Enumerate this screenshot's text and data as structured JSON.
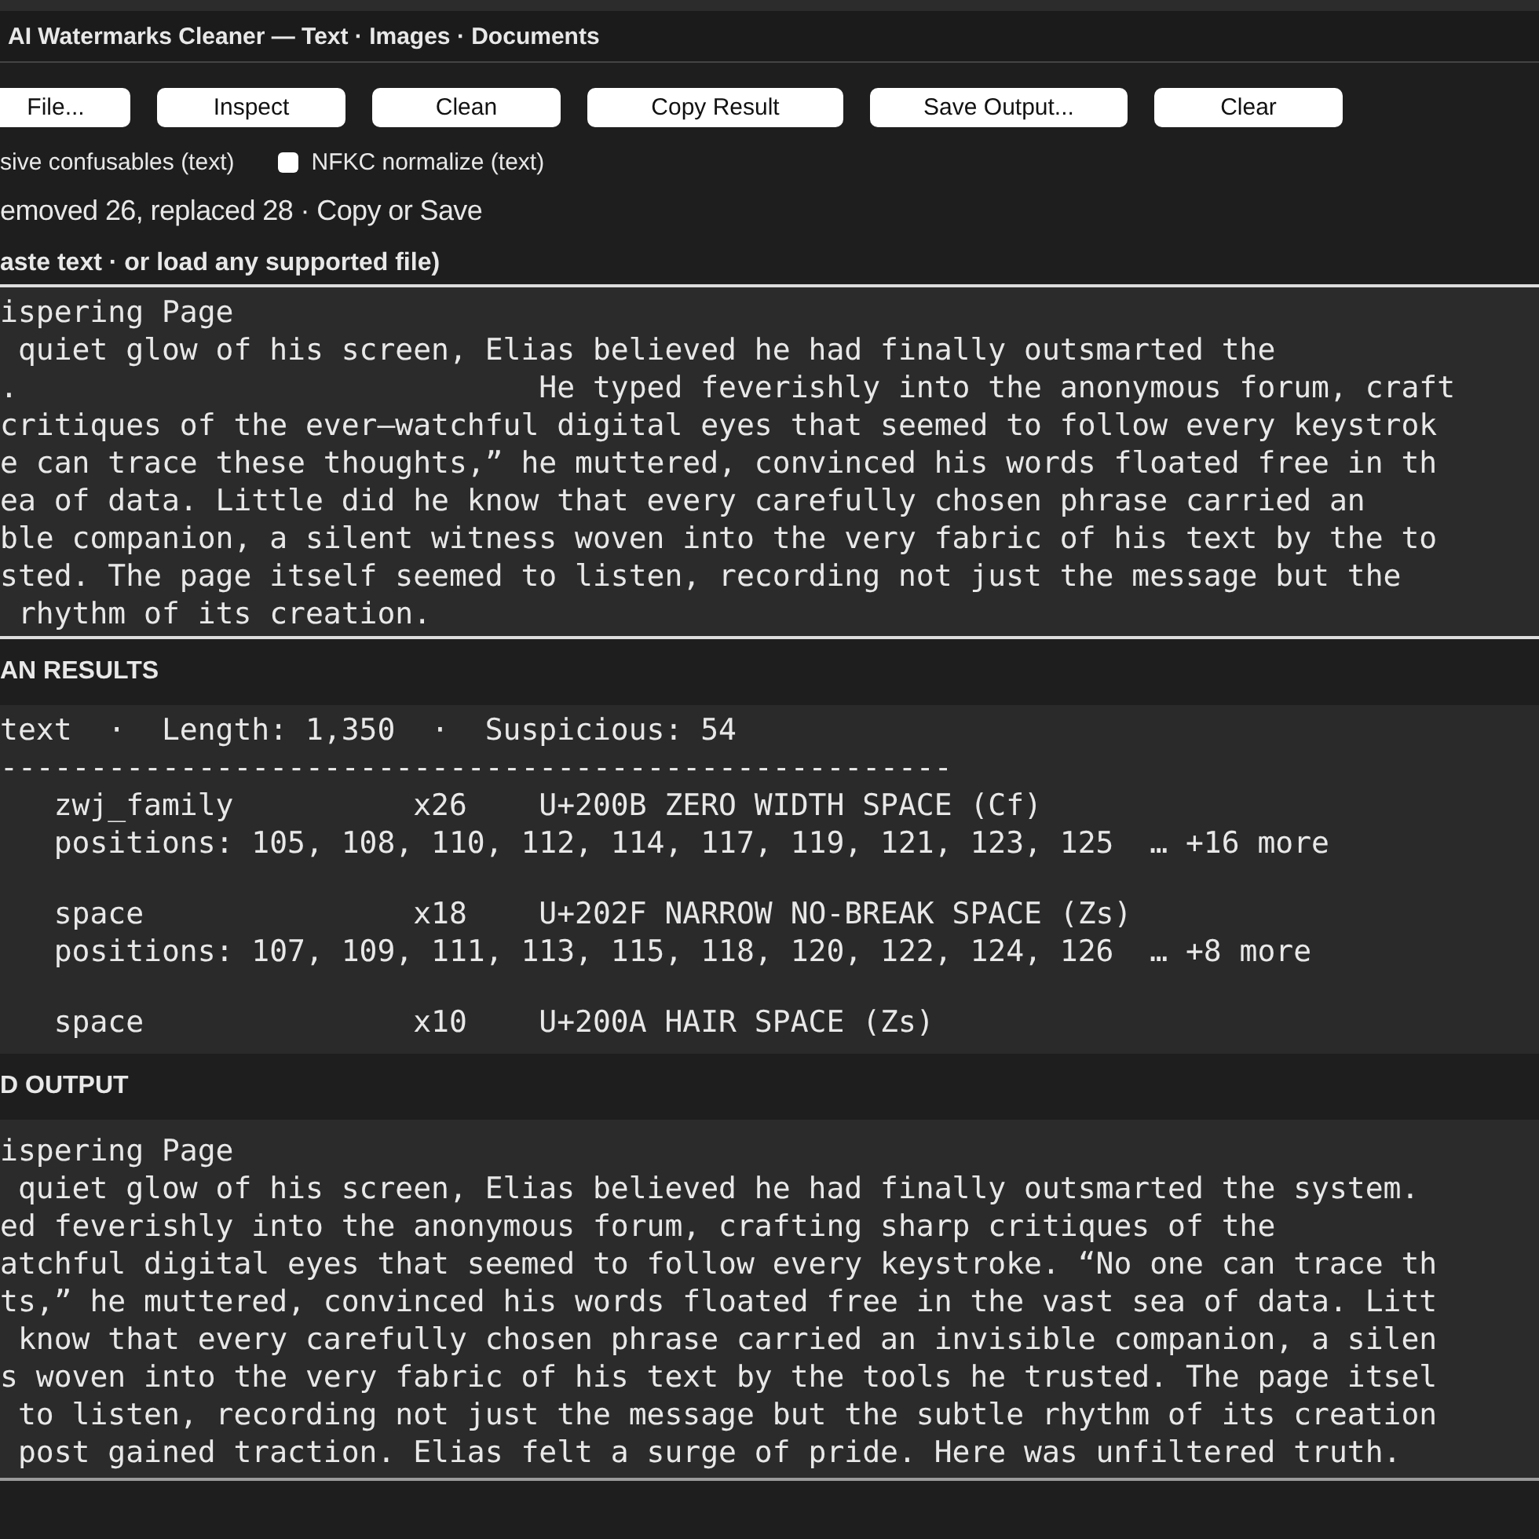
{
  "window": {
    "title": "AI Watermarks Cleaner — Text · Images · Documents"
  },
  "buttons": [
    "File...",
    "Inspect",
    "Clean",
    "Copy Result",
    "Save Output...",
    "Clear"
  ],
  "options": [
    {
      "kind": "label",
      "label": "sive confusables (text)"
    },
    {
      "kind": "checkbox",
      "label": "NFKC normalize (text)",
      "checked": false
    }
  ],
  "status": "emoved 26, replaced 28  ·  Copy or Save",
  "input_label": "aste text  ·  or load any supported file)",
  "input_lines": [
    "ispering Page",
    " quiet glow of his screen, Elias believed he had finally outsmarted the",
    ".                             He typed feverishly into the anonymous forum, craft",
    "critiques of the ever—watchful digital eyes that seemed to follow every keystrok",
    "e can trace these thoughts,” he muttered, convinced his words floated free in th",
    "ea of data. Little did he know that every carefully chosen phrase carried an",
    "ble companion, a silent witness woven into the very fabric of his text by the to",
    "sted. The page itself seemed to listen, recording not just the message but the",
    " rhythm of its creation."
  ],
  "results_header": "AN RESULTS",
  "results_summary": "text  ·  Length: 1,350  ·  Suspicious: 54",
  "results_separator": "-----------------------------------------------------",
  "results_entries": [
    {
      "line": "   zwj_family          x26    U+200B ZERO WIDTH SPACE (Cf)",
      "positions": "   positions: 105, 108, 110, 112, 114, 117, 119, 121, 123, 125  … +16 more"
    },
    {
      "line": "   space               x18    U+202F NARROW NO-BREAK SPACE (Zs)",
      "positions": "   positions: 107, 109, 111, 113, 115, 118, 120, 122, 124, 126  … +8 more"
    },
    {
      "line": "   space               x10    U+200A HAIR SPACE (Zs)"
    }
  ],
  "output_header": "D OUTPUT",
  "output_lines": [
    "ispering Page",
    " quiet glow of his screen, Elias believed he had finally outsmarted the system.",
    "ed feverishly into the anonymous forum, crafting sharp critiques of the",
    "atchful digital eyes that seemed to follow every keystroke. “No one can trace th",
    "ts,” he muttered, convinced his words floated free in the vast sea of data. Litt",
    " know that every carefully chosen phrase carried an invisible companion, a silen",
    "s woven into the very fabric of his text by the tools he trusted. The page itsel",
    " to listen, recording not just the message but the subtle rhythm of its creation",
    " post gained traction. Elias felt a surge of pride. Here was unfiltered truth."
  ]
}
